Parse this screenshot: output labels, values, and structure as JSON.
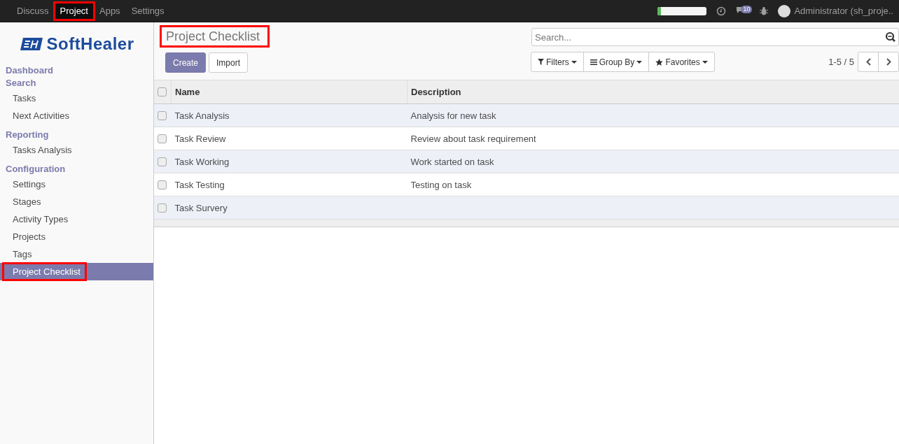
{
  "top_menu": [
    {
      "label": "Discuss",
      "selected": false,
      "highlighted": false
    },
    {
      "label": "Project",
      "selected": true,
      "highlighted": true
    },
    {
      "label": "Apps",
      "selected": false,
      "highlighted": false
    },
    {
      "label": "Settings",
      "selected": false,
      "highlighted": false
    }
  ],
  "systray": {
    "progress": {
      "level": 0.06
    },
    "message_count": "10",
    "user": "Administrator (sh_proje.."
  },
  "sidebar": {
    "logo": "SoftHealer",
    "sections": [
      {
        "label": "Dashboard"
      },
      {
        "label": "Search",
        "items": [
          {
            "label": "Tasks",
            "selected": false,
            "highlighted": false
          },
          {
            "label": "Next Activities",
            "selected": false,
            "highlighted": false
          }
        ]
      },
      {
        "label": "Reporting",
        "items": [
          {
            "label": "Tasks Analysis",
            "selected": false,
            "highlighted": false
          }
        ]
      },
      {
        "label": "Configuration",
        "items": [
          {
            "label": "Settings",
            "selected": false,
            "highlighted": false
          },
          {
            "label": "Stages",
            "selected": false,
            "highlighted": false
          },
          {
            "label": "Activity Types",
            "selected": false,
            "highlighted": false
          },
          {
            "label": "Projects",
            "selected": false,
            "highlighted": false
          },
          {
            "label": "Tags",
            "selected": false,
            "highlighted": false
          },
          {
            "label": "Project Checklist",
            "selected": true,
            "highlighted": true
          }
        ]
      }
    ]
  },
  "control_panel": {
    "title": "Project Checklist",
    "title_highlighted": true,
    "buttons": [
      {
        "label": "Create",
        "kind": "primary"
      },
      {
        "label": "Import",
        "kind": "secondary"
      }
    ],
    "search": {
      "placeholder": "Search..."
    },
    "filters": [
      "Filters",
      "Group By",
      "Favorites"
    ],
    "pager": "1-5 / 5"
  },
  "table": {
    "header_checked": false,
    "columns": [
      "Name",
      "Description"
    ],
    "rows": [
      {
        "checked": false,
        "cells": [
          "Task Analysis",
          "Analysis for new task"
        ]
      },
      {
        "checked": false,
        "cells": [
          "Task Review",
          "Review about task requirement"
        ]
      },
      {
        "checked": false,
        "cells": [
          "Task Working",
          "Work started on task"
        ]
      },
      {
        "checked": false,
        "cells": [
          "Task Testing",
          "Testing on task"
        ]
      },
      {
        "checked": false,
        "cells": [
          "Task Survery"
        ]
      }
    ]
  }
}
